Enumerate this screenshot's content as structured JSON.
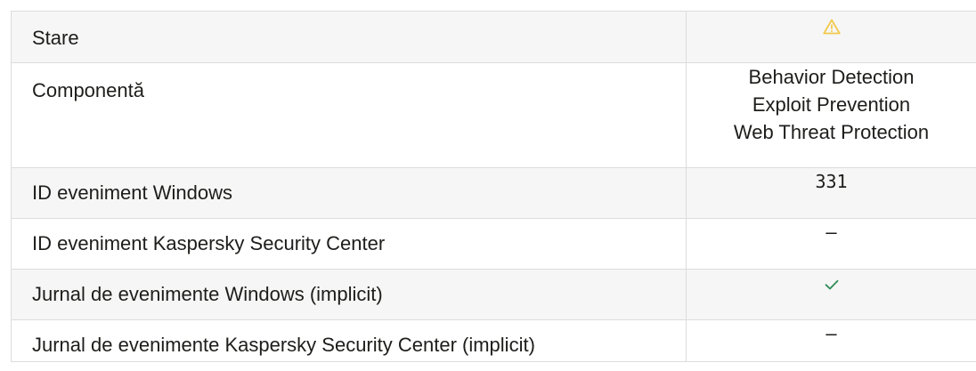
{
  "colors": {
    "warning": "#f5c518",
    "check": "#2e8b57",
    "border": "#dcdcdc",
    "row_alt": "#f6f6f6"
  },
  "rows": [
    {
      "label": "Stare",
      "value_icon": "warning-triangle-icon"
    },
    {
      "label": "Componentă",
      "values": [
        "Behavior Detection",
        "Exploit Prevention",
        "Web Threat Protection"
      ]
    },
    {
      "label": "ID eveniment Windows",
      "value": "331"
    },
    {
      "label": "ID eveniment Kaspersky Security Center",
      "value": "–"
    },
    {
      "label": "Jurnal de evenimente Windows (implicit)",
      "value_icon": "checkmark-icon"
    },
    {
      "label": "Jurnal de evenimente Kaspersky Security Center (implicit)",
      "value": "–"
    }
  ]
}
